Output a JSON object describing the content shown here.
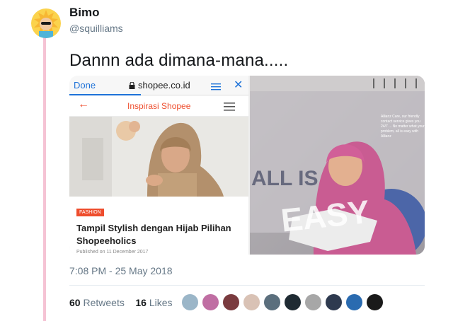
{
  "tweet": {
    "display_name": "Bimo",
    "handle": "@squilliams",
    "text": "Dannn ada dimana-mana.....",
    "timestamp": "7:08 PM - 25 May 2018",
    "retweets_count": "60",
    "retweets_label": "Retweets",
    "likes_count": "16",
    "likes_label": "Likes"
  },
  "screenshot": {
    "browser_done": "Done",
    "browser_url": "shopee.co.id",
    "app_title": "Inspirasi Shopee",
    "tag": "FASHION",
    "article_title": "Tampil Stylish dengan Hijab Pilihan Shopeeholics",
    "published": "Published on 11 December 2017"
  },
  "calendar_photo": {
    "big_text_1": "ALL IS",
    "big_text_2": "EASY",
    "small_text": "Allianz Care, our friendly contact service gives you 24/7 ... No matter what your problem, all is easy with Allianz"
  },
  "colors": {
    "accent": "#1da1f2",
    "shopee_orange": "#ee4d2d",
    "thread_line": "#f5c3d4"
  },
  "likers": [
    "user-1",
    "user-2",
    "user-3",
    "user-4",
    "user-5",
    "user-6",
    "user-7",
    "user-8",
    "user-9",
    "user-10"
  ]
}
